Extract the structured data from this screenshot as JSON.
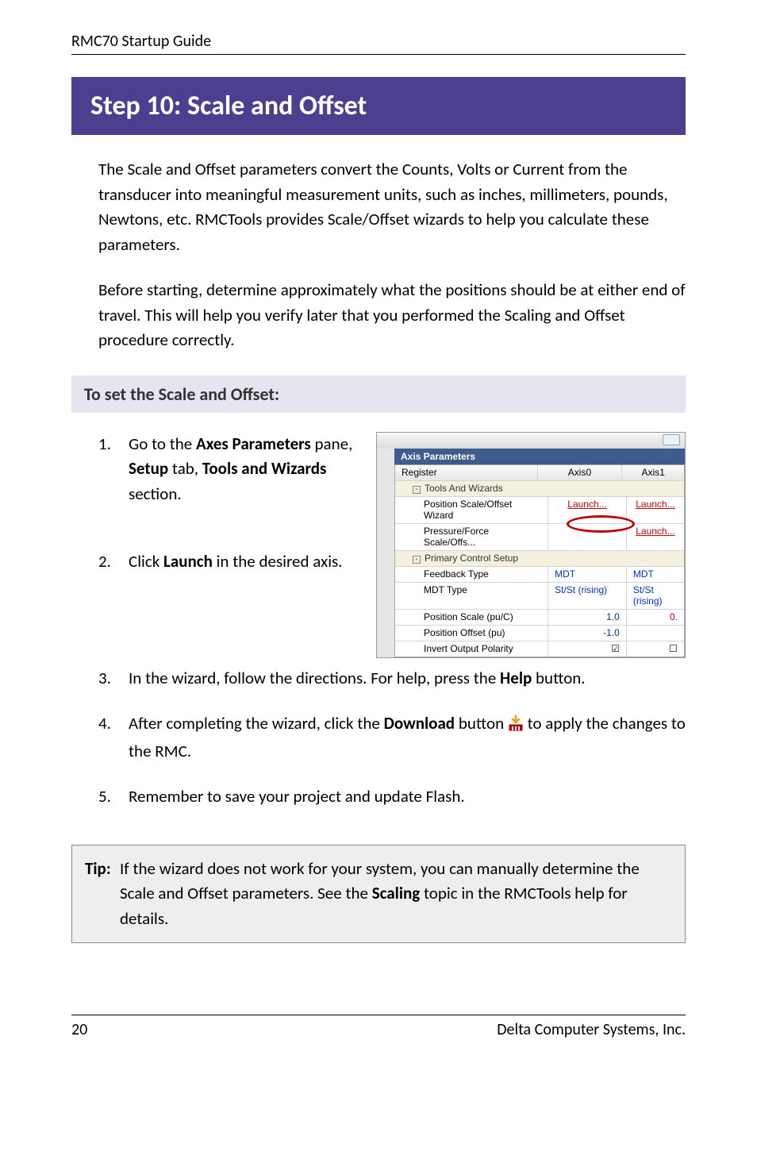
{
  "header": "RMC70 Startup Guide",
  "banner": "Step 10: Scale and Offset",
  "para1": "The Scale and Offset parameters convert the Counts, Volts or Current from the transducer into meaningful measurement units, such as inches, millimeters, pounds, Newtons, etc. RMCTools provides Scale/Offset wizards to help you calculate these parameters.",
  "para2": "Before starting, determine approximately what the positions should be at either end of travel. This will help you verify later that you performed the Scaling and Offset procedure correctly.",
  "subhead": "To set the Scale and Offset:",
  "steps": {
    "s1_a": "Go to the ",
    "s1_b": "Axes Parameters",
    "s1_c": " pane, ",
    "s1_d": "Setup",
    "s1_e": " tab, ",
    "s1_f": "Tools and Wizards",
    "s1_g": " section.",
    "s2_a": "Click ",
    "s2_b": "Launch",
    "s2_c": " in the desired axis.",
    "s3_a": "In the wizard, follow the directions. For help, press the ",
    "s3_b": "Help",
    "s3_c": " button.",
    "s4_a": "After completing the wizard, click the ",
    "s4_b": "Download",
    "s4_c": " button ",
    "s4_d": " to apply the changes to the RMC.",
    "s5": "Remember to save your project and update Flash."
  },
  "tip": {
    "label": "Tip:",
    "text_a": "If the wizard does not work for your system, you can manually determine the Scale and Offset parameters. See the ",
    "text_b": "Scaling",
    "text_c": " topic in the RMCTools help for details."
  },
  "footer": {
    "page": "20",
    "org": "Delta Computer Systems, Inc."
  },
  "screenshot": {
    "title": "Axis Parameters",
    "cols": {
      "c1": "Register",
      "c2": "Axis0",
      "c3": "Axis1"
    },
    "group1": "Tools And Wizards",
    "row1": {
      "name": "Position Scale/Offset Wizard",
      "a": "Launch...",
      "b": "Launch..."
    },
    "row2": {
      "name": "Pressure/Force Scale/Offs...",
      "a": "",
      "b": "Launch..."
    },
    "group2": "Primary Control Setup",
    "row3": {
      "name": "Feedback Type",
      "a": "MDT",
      "b": "MDT"
    },
    "row4": {
      "name": "MDT Type",
      "a": "St/St (rising)",
      "b": "St/St (rising)"
    },
    "row5": {
      "name": "Position Scale (pu/C)",
      "a": "1.0",
      "b": "0."
    },
    "row6": {
      "name": "Position Offset (pu)",
      "a": "-1.0",
      "b": ""
    },
    "row7": {
      "name": "Invert Output Polarity"
    }
  }
}
